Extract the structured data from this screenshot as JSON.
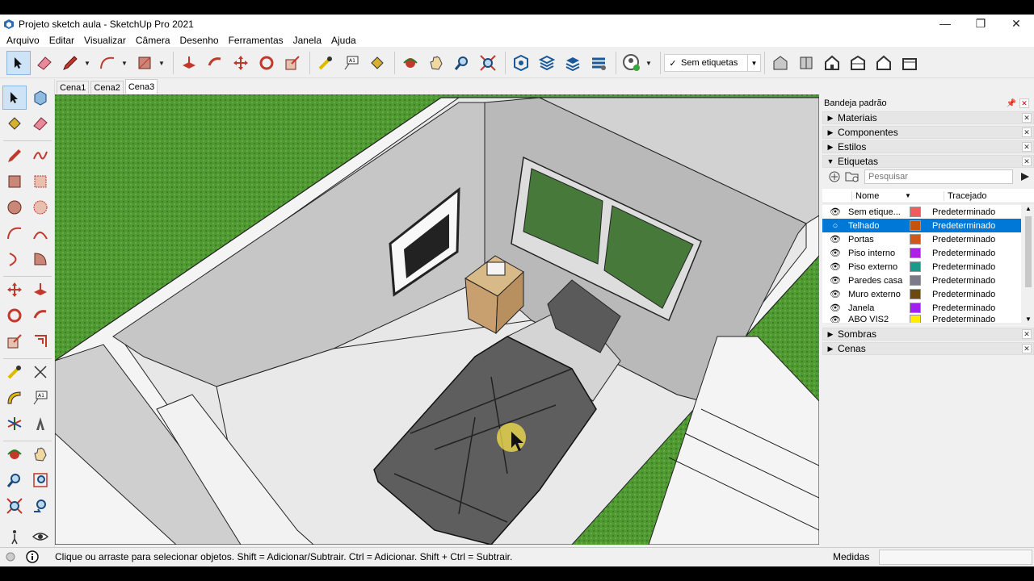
{
  "window": {
    "title": "Projeto sketch aula - SketchUp Pro 2021",
    "minimize": "—",
    "restore": "❐",
    "close": "✕"
  },
  "menu": [
    "Arquivo",
    "Editar",
    "Visualizar",
    "Câmera",
    "Desenho",
    "Ferramentas",
    "Janela",
    "Ajuda"
  ],
  "toolbar": {
    "tag_selector_value": "Sem etiquetas",
    "tag_selector_check": "✓"
  },
  "scenes": [
    "Cena1",
    "Cena2",
    "Cena3"
  ],
  "active_scene": "Cena3",
  "tray": {
    "title": "Bandeja padrão",
    "panels_collapsed_top": [
      "Materiais",
      "Componentes",
      "Estilos"
    ],
    "tags_panel": "Etiquetas",
    "panels_collapsed_bottom": [
      "Sombras",
      "Cenas"
    ],
    "search_placeholder": "Pesquisar",
    "col_name": "Nome",
    "col_dash": "Tracejado",
    "tags": [
      {
        "name": "Sem etique...",
        "color": "#f25c5c",
        "dash": "Predeterminado",
        "selected": false
      },
      {
        "name": "Telhado",
        "color": "#c8520c",
        "dash": "Predeterminado",
        "selected": true
      },
      {
        "name": "Portas",
        "color": "#d0571a",
        "dash": "Predeterminado",
        "selected": false
      },
      {
        "name": "Piso interno",
        "color": "#b020e0",
        "dash": "Predeterminado",
        "selected": false
      },
      {
        "name": "Piso externo",
        "color": "#1a9a8a",
        "dash": "Predeterminado",
        "selected": false
      },
      {
        "name": "Paredes casa",
        "color": "#7a7a8a",
        "dash": "Predeterminado",
        "selected": false
      },
      {
        "name": "Muro externo",
        "color": "#6a4a10",
        "dash": "Predeterminado",
        "selected": false
      },
      {
        "name": "Janela",
        "color": "#a020f0",
        "dash": "Predeterminado",
        "selected": false
      },
      {
        "name": "ABO VIS2",
        "color": "#ffee00",
        "dash": "Predeterminado",
        "selected": false
      }
    ]
  },
  "status": {
    "hint": "Clique ou arraste para selecionar objetos. Shift = Adicionar/Subtrair. Ctrl = Adicionar. Shift + Ctrl = Subtrair.",
    "measures_label": "Medidas",
    "measures_value": ""
  }
}
